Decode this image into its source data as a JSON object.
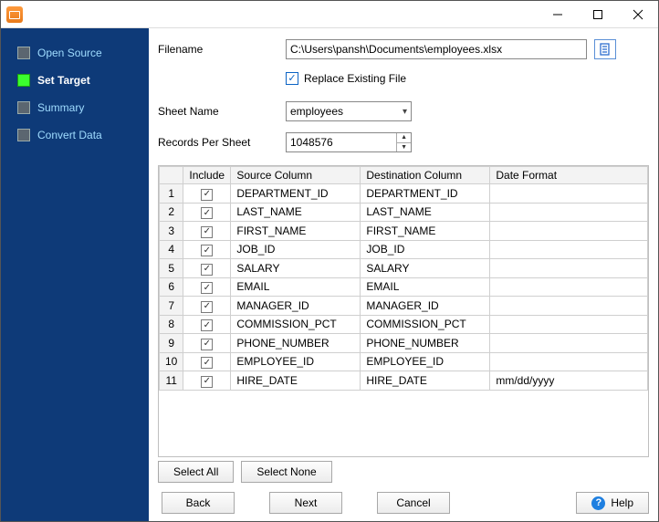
{
  "title": "",
  "sidebar": {
    "items": [
      {
        "label": "Open Source",
        "active": false
      },
      {
        "label": "Set Target",
        "active": true
      },
      {
        "label": "Summary",
        "active": false
      },
      {
        "label": "Convert Data",
        "active": false
      }
    ]
  },
  "form": {
    "filename_label": "Filename",
    "filename_value": "C:\\Users\\pansh\\Documents\\employees.xlsx",
    "replace_label": "Replace Existing File",
    "replace_on": true,
    "sheet_label": "Sheet Name",
    "sheet_value": "employees",
    "records_label": "Records Per Sheet",
    "records_value": "1048576"
  },
  "grid": {
    "headers": {
      "include": "Include",
      "source": "Source Column",
      "dest": "Destination Column",
      "date": "Date Format"
    },
    "rows": [
      {
        "n": "1",
        "inc": true,
        "src": "DEPARTMENT_ID",
        "dst": "DEPARTMENT_ID",
        "fmt": ""
      },
      {
        "n": "2",
        "inc": true,
        "src": "LAST_NAME",
        "dst": "LAST_NAME",
        "fmt": ""
      },
      {
        "n": "3",
        "inc": true,
        "src": "FIRST_NAME",
        "dst": "FIRST_NAME",
        "fmt": ""
      },
      {
        "n": "4",
        "inc": true,
        "src": "JOB_ID",
        "dst": "JOB_ID",
        "fmt": ""
      },
      {
        "n": "5",
        "inc": true,
        "src": "SALARY",
        "dst": "SALARY",
        "fmt": ""
      },
      {
        "n": "6",
        "inc": true,
        "src": "EMAIL",
        "dst": "EMAIL",
        "fmt": ""
      },
      {
        "n": "7",
        "inc": true,
        "src": "MANAGER_ID",
        "dst": "MANAGER_ID",
        "fmt": ""
      },
      {
        "n": "8",
        "inc": true,
        "src": "COMMISSION_PCT",
        "dst": "COMMISSION_PCT",
        "fmt": ""
      },
      {
        "n": "9",
        "inc": true,
        "src": "PHONE_NUMBER",
        "dst": "PHONE_NUMBER",
        "fmt": ""
      },
      {
        "n": "10",
        "inc": true,
        "src": "EMPLOYEE_ID",
        "dst": "EMPLOYEE_ID",
        "fmt": ""
      },
      {
        "n": "11",
        "inc": true,
        "src": "HIRE_DATE",
        "dst": "HIRE_DATE",
        "fmt": "mm/dd/yyyy"
      }
    ]
  },
  "buttons": {
    "select_all": "Select All",
    "select_none": "Select None",
    "back": "Back",
    "next": "Next",
    "cancel": "Cancel",
    "help": "Help"
  }
}
